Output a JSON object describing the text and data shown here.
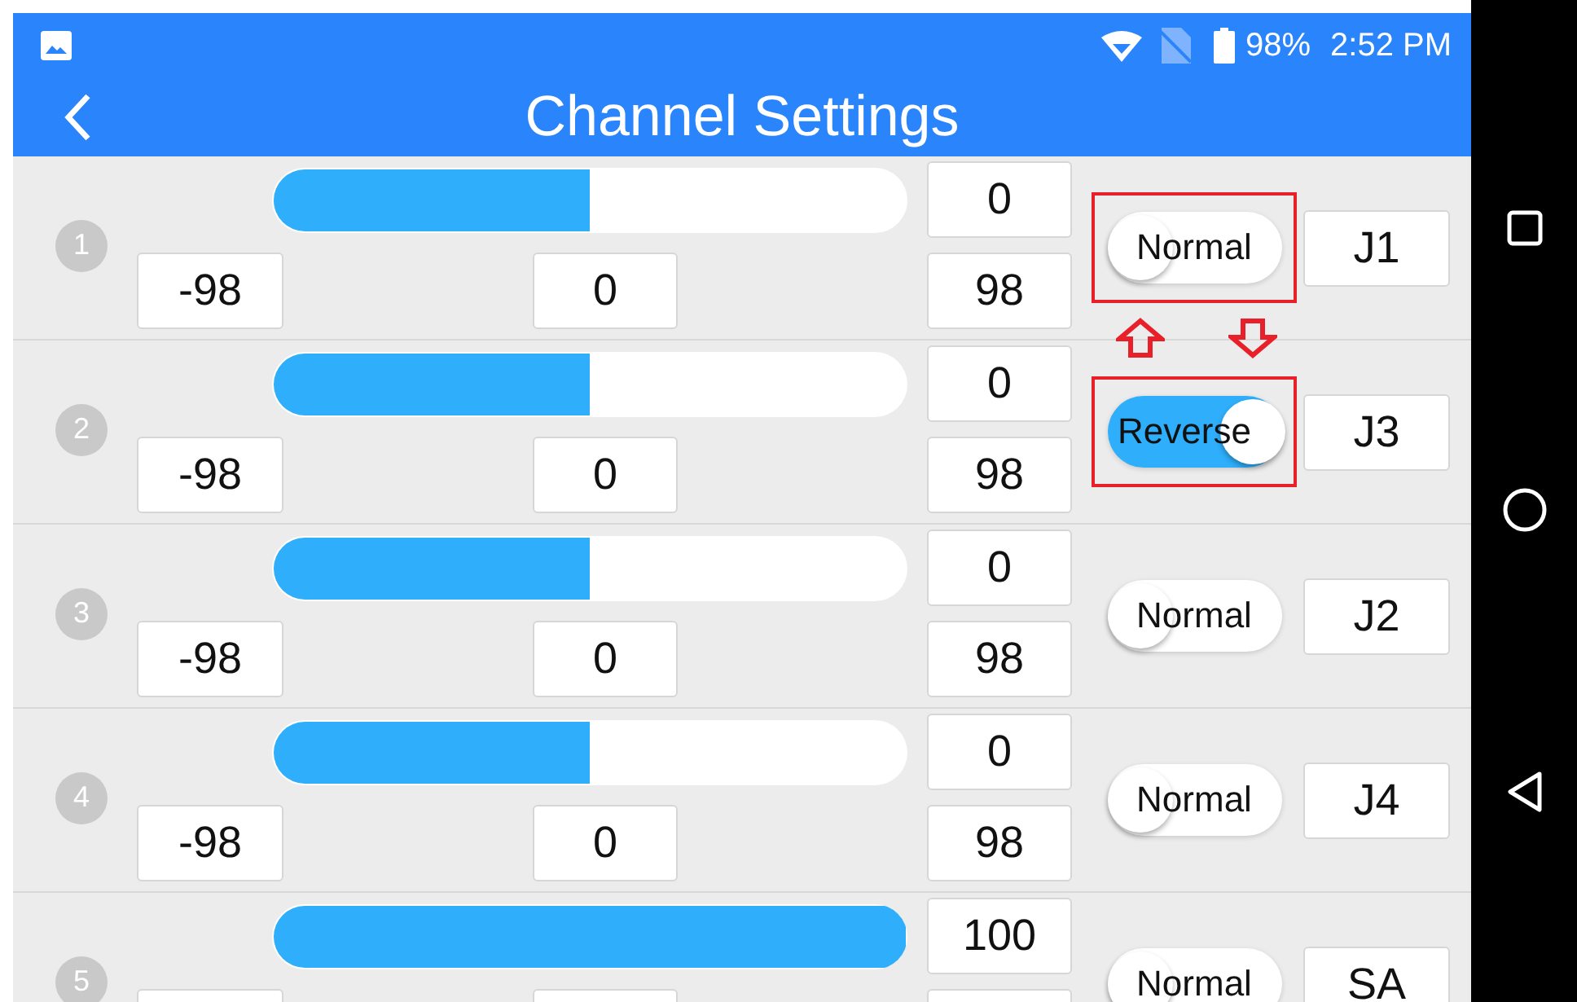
{
  "status_bar": {
    "battery": "98%",
    "time": "2:52 PM"
  },
  "header": {
    "title": "Channel Settings"
  },
  "channels": [
    {
      "number": "1",
      "level": 0.5,
      "top_value": "0",
      "min": "-98",
      "center": "0",
      "max": "98",
      "mode": "Normal",
      "reversed": false,
      "highlighted": true,
      "source": "J1"
    },
    {
      "number": "2",
      "level": 0.5,
      "top_value": "0",
      "min": "-98",
      "center": "0",
      "max": "98",
      "mode": "Reverse",
      "reversed": true,
      "highlighted": true,
      "source": "J3"
    },
    {
      "number": "3",
      "level": 0.5,
      "top_value": "0",
      "min": "-98",
      "center": "0",
      "max": "98",
      "mode": "Normal",
      "reversed": false,
      "highlighted": false,
      "source": "J2"
    },
    {
      "number": "4",
      "level": 0.5,
      "top_value": "0",
      "min": "-98",
      "center": "0",
      "max": "98",
      "mode": "Normal",
      "reversed": false,
      "highlighted": false,
      "source": "J4"
    },
    {
      "number": "5",
      "level": 1,
      "top_value": "100",
      "mode": "Normal",
      "reversed": false,
      "highlighted": false,
      "source": "SA"
    }
  ],
  "annotation_arrows": [
    {
      "kind": "up"
    },
    {
      "kind": "down"
    }
  ]
}
